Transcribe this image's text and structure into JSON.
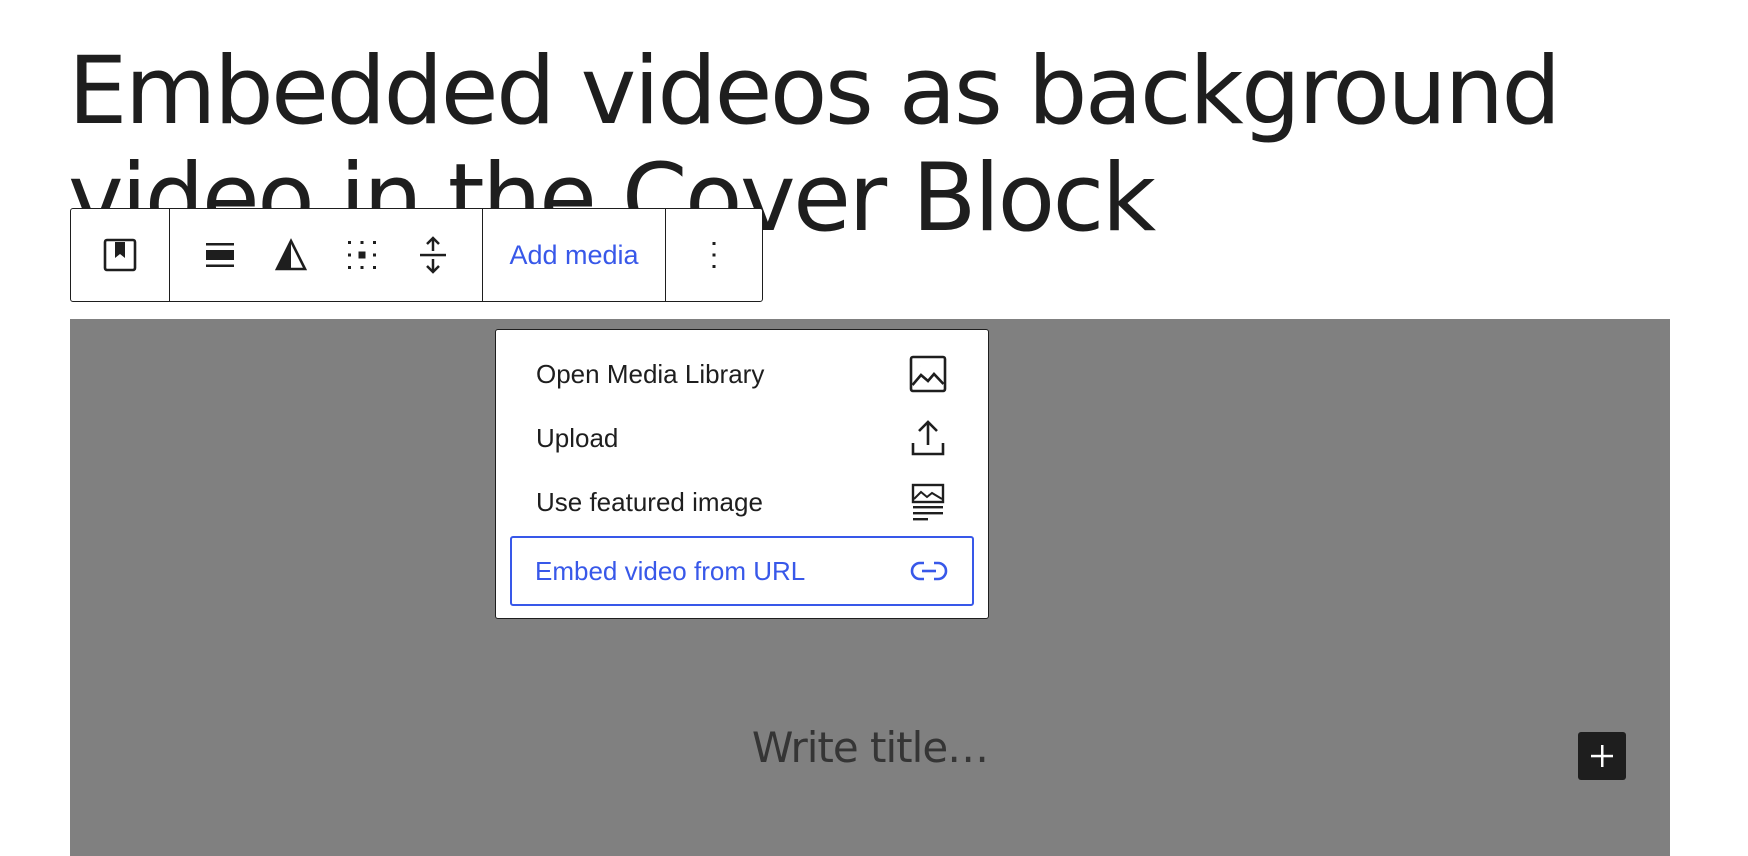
{
  "post": {
    "title": "Embedded videos as background video in the Cover Block"
  },
  "toolbar": {
    "add_media_label": "Add media"
  },
  "media_menu": {
    "items": [
      {
        "label": "Open Media Library",
        "icon": "image-icon"
      },
      {
        "label": "Upload",
        "icon": "upload-icon"
      },
      {
        "label": "Use featured image",
        "icon": "featured-image-icon"
      },
      {
        "label": "Embed video from URL",
        "icon": "link-icon",
        "active": true
      }
    ]
  },
  "cover": {
    "title_placeholder": "Write title…",
    "overlay_color": "#808080"
  },
  "colors": {
    "accent": "#3858e9",
    "text": "#1e1e1e"
  }
}
